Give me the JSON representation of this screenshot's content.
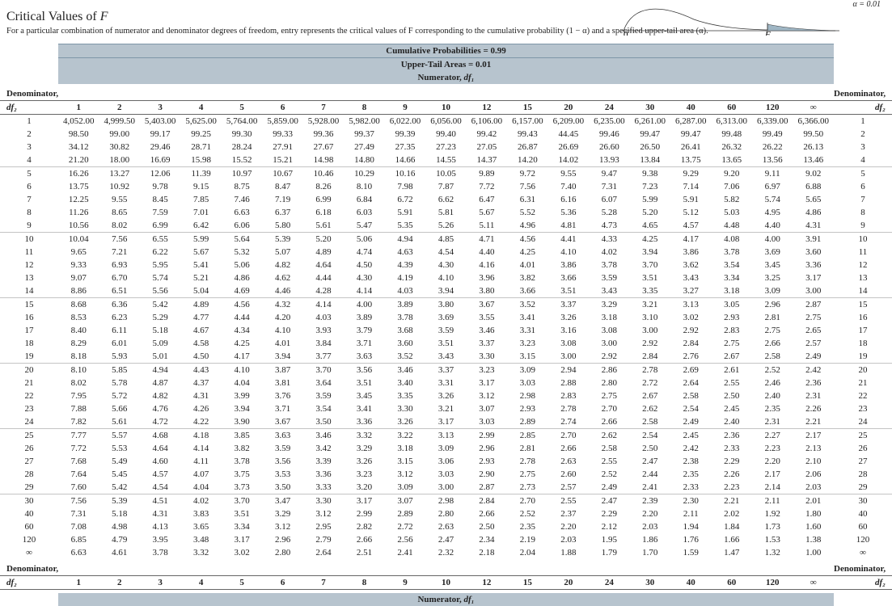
{
  "title_prefix": "Critical Values of ",
  "title_var": "F",
  "description": "For a particular combination of numerator and denominator degrees of freedom, entry represents the critical values of F corresponding to the cumulative probability (1 − α) and a specified upper-tail area (α).",
  "alpha_note": "α = 0.01",
  "curve": {
    "zero": "0",
    "F": "F"
  },
  "banners": {
    "cum": "Cumulative Probabilities = 0.99",
    "tail": "Upper-Tail Areas = 0.01",
    "numerator": "Numerator, ",
    "numerator_sym": "df₁"
  },
  "denom_label": "Denominator,",
  "denom_sym": "df₂",
  "col_headers": [
    "1",
    "2",
    "3",
    "4",
    "5",
    "6",
    "7",
    "8",
    "9",
    "10",
    "12",
    "15",
    "20",
    "24",
    "30",
    "40",
    "60",
    "120",
    "∞"
  ],
  "groups": [
    [
      {
        "df": "1",
        "v": [
          "4,052.00",
          "4,999.50",
          "5,403.00",
          "5,625.00",
          "5,764.00",
          "5,859.00",
          "5,928.00",
          "5,982.00",
          "6,022.00",
          "6,056.00",
          "6,106.00",
          "6,157.00",
          "6,209.00",
          "6,235.00",
          "6,261.00",
          "6,287.00",
          "6,313.00",
          "6,339.00",
          "6,366.00"
        ]
      },
      {
        "df": "2",
        "v": [
          "98.50",
          "99.00",
          "99.17",
          "99.25",
          "99.30",
          "99.33",
          "99.36",
          "99.37",
          "99.39",
          "99.40",
          "99.42",
          "99.43",
          "44.45",
          "99.46",
          "99.47",
          "99.47",
          "99.48",
          "99.49",
          "99.50"
        ]
      },
      {
        "df": "3",
        "v": [
          "34.12",
          "30.82",
          "29.46",
          "28.71",
          "28.24",
          "27.91",
          "27.67",
          "27.49",
          "27.35",
          "27.23",
          "27.05",
          "26.87",
          "26.69",
          "26.60",
          "26.50",
          "26.41",
          "26.32",
          "26.22",
          "26.13"
        ]
      },
      {
        "df": "4",
        "v": [
          "21.20",
          "18.00",
          "16.69",
          "15.98",
          "15.52",
          "15.21",
          "14.98",
          "14.80",
          "14.66",
          "14.55",
          "14.37",
          "14.20",
          "14.02",
          "13.93",
          "13.84",
          "13.75",
          "13.65",
          "13.56",
          "13.46"
        ]
      }
    ],
    [
      {
        "df": "5",
        "v": [
          "16.26",
          "13.27",
          "12.06",
          "11.39",
          "10.97",
          "10.67",
          "10.46",
          "10.29",
          "10.16",
          "10.05",
          "9.89",
          "9.72",
          "9.55",
          "9.47",
          "9.38",
          "9.29",
          "9.20",
          "9.11",
          "9.02"
        ]
      },
      {
        "df": "6",
        "v": [
          "13.75",
          "10.92",
          "9.78",
          "9.15",
          "8.75",
          "8.47",
          "8.26",
          "8.10",
          "7.98",
          "7.87",
          "7.72",
          "7.56",
          "7.40",
          "7.31",
          "7.23",
          "7.14",
          "7.06",
          "6.97",
          "6.88"
        ]
      },
      {
        "df": "7",
        "v": [
          "12.25",
          "9.55",
          "8.45",
          "7.85",
          "7.46",
          "7.19",
          "6.99",
          "6.84",
          "6.72",
          "6.62",
          "6.47",
          "6.31",
          "6.16",
          "6.07",
          "5.99",
          "5.91",
          "5.82",
          "5.74",
          "5.65"
        ]
      },
      {
        "df": "8",
        "v": [
          "11.26",
          "8.65",
          "7.59",
          "7.01",
          "6.63",
          "6.37",
          "6.18",
          "6.03",
          "5.91",
          "5.81",
          "5.67",
          "5.52",
          "5.36",
          "5.28",
          "5.20",
          "5.12",
          "5.03",
          "4.95",
          "4.86"
        ]
      },
      {
        "df": "9",
        "v": [
          "10.56",
          "8.02",
          "6.99",
          "6.42",
          "6.06",
          "5.80",
          "5.61",
          "5.47",
          "5.35",
          "5.26",
          "5.11",
          "4.96",
          "4.81",
          "4.73",
          "4.65",
          "4.57",
          "4.48",
          "4.40",
          "4.31"
        ]
      }
    ],
    [
      {
        "df": "10",
        "v": [
          "10.04",
          "7.56",
          "6.55",
          "5.99",
          "5.64",
          "5.39",
          "5.20",
          "5.06",
          "4.94",
          "4.85",
          "4.71",
          "4.56",
          "4.41",
          "4.33",
          "4.25",
          "4.17",
          "4.08",
          "4.00",
          "3.91"
        ]
      },
      {
        "df": "11",
        "v": [
          "9.65",
          "7.21",
          "6.22",
          "5.67",
          "5.32",
          "5.07",
          "4.89",
          "4.74",
          "4.63",
          "4.54",
          "4.40",
          "4.25",
          "4.10",
          "4.02",
          "3.94",
          "3.86",
          "3.78",
          "3.69",
          "3.60"
        ]
      },
      {
        "df": "12",
        "v": [
          "9.33",
          "6.93",
          "5.95",
          "5.41",
          "5.06",
          "4.82",
          "4.64",
          "4.50",
          "4.39",
          "4.30",
          "4.16",
          "4.01",
          "3.86",
          "3.78",
          "3.70",
          "3.62",
          "3.54",
          "3.45",
          "3.36"
        ]
      },
      {
        "df": "13",
        "v": [
          "9.07",
          "6.70",
          "5.74",
          "5.21",
          "4.86",
          "4.62",
          "4.44",
          "4.30",
          "4.19",
          "4.10",
          "3.96",
          "3.82",
          "3.66",
          "3.59",
          "3.51",
          "3.43",
          "3.34",
          "3.25",
          "3.17"
        ]
      },
      {
        "df": "14",
        "v": [
          "8.86",
          "6.51",
          "5.56",
          "5.04",
          "4.69",
          "4.46",
          "4.28",
          "4.14",
          "4.03",
          "3.94",
          "3.80",
          "3.66",
          "3.51",
          "3.43",
          "3.35",
          "3.27",
          "3.18",
          "3.09",
          "3.00"
        ]
      }
    ],
    [
      {
        "df": "15",
        "v": [
          "8.68",
          "6.36",
          "5.42",
          "4.89",
          "4.56",
          "4.32",
          "4.14",
          "4.00",
          "3.89",
          "3.80",
          "3.67",
          "3.52",
          "3.37",
          "3.29",
          "3.21",
          "3.13",
          "3.05",
          "2.96",
          "2.87"
        ]
      },
      {
        "df": "16",
        "v": [
          "8.53",
          "6.23",
          "5.29",
          "4.77",
          "4.44",
          "4.20",
          "4.03",
          "3.89",
          "3.78",
          "3.69",
          "3.55",
          "3.41",
          "3.26",
          "3.18",
          "3.10",
          "3.02",
          "2.93",
          "2.81",
          "2.75"
        ]
      },
      {
        "df": "17",
        "v": [
          "8.40",
          "6.11",
          "5.18",
          "4.67",
          "4.34",
          "4.10",
          "3.93",
          "3.79",
          "3.68",
          "3.59",
          "3.46",
          "3.31",
          "3.16",
          "3.08",
          "3.00",
          "2.92",
          "2.83",
          "2.75",
          "2.65"
        ]
      },
      {
        "df": "18",
        "v": [
          "8.29",
          "6.01",
          "5.09",
          "4.58",
          "4.25",
          "4.01",
          "3.84",
          "3.71",
          "3.60",
          "3.51",
          "3.37",
          "3.23",
          "3.08",
          "3.00",
          "2.92",
          "2.84",
          "2.75",
          "2.66",
          "2.57"
        ]
      },
      {
        "df": "19",
        "v": [
          "8.18",
          "5.93",
          "5.01",
          "4.50",
          "4.17",
          "3.94",
          "3.77",
          "3.63",
          "3.52",
          "3.43",
          "3.30",
          "3.15",
          "3.00",
          "2.92",
          "2.84",
          "2.76",
          "2.67",
          "2.58",
          "2.49"
        ]
      }
    ],
    [
      {
        "df": "20",
        "v": [
          "8.10",
          "5.85",
          "4.94",
          "4.43",
          "4.10",
          "3.87",
          "3.70",
          "3.56",
          "3.46",
          "3.37",
          "3.23",
          "3.09",
          "2.94",
          "2.86",
          "2.78",
          "2.69",
          "2.61",
          "2.52",
          "2.42"
        ]
      },
      {
        "df": "21",
        "v": [
          "8.02",
          "5.78",
          "4.87",
          "4.37",
          "4.04",
          "3.81",
          "3.64",
          "3.51",
          "3.40",
          "3.31",
          "3.17",
          "3.03",
          "2.88",
          "2.80",
          "2.72",
          "2.64",
          "2.55",
          "2.46",
          "2.36"
        ]
      },
      {
        "df": "22",
        "v": [
          "7.95",
          "5.72",
          "4.82",
          "4.31",
          "3.99",
          "3.76",
          "3.59",
          "3.45",
          "3.35",
          "3.26",
          "3.12",
          "2.98",
          "2.83",
          "2.75",
          "2.67",
          "2.58",
          "2.50",
          "2.40",
          "2.31"
        ]
      },
      {
        "df": "23",
        "v": [
          "7.88",
          "5.66",
          "4.76",
          "4.26",
          "3.94",
          "3.71",
          "3.54",
          "3.41",
          "3.30",
          "3.21",
          "3.07",
          "2.93",
          "2.78",
          "2.70",
          "2.62",
          "2.54",
          "2.45",
          "2.35",
          "2.26"
        ]
      },
      {
        "df": "24",
        "v": [
          "7.82",
          "5.61",
          "4.72",
          "4.22",
          "3.90",
          "3.67",
          "3.50",
          "3.36",
          "3.26",
          "3.17",
          "3.03",
          "2.89",
          "2.74",
          "2.66",
          "2.58",
          "2.49",
          "2.40",
          "2.31",
          "2.21"
        ]
      }
    ],
    [
      {
        "df": "25",
        "v": [
          "7.77",
          "5.57",
          "4.68",
          "4.18",
          "3.85",
          "3.63",
          "3.46",
          "3.32",
          "3.22",
          "3.13",
          "2.99",
          "2.85",
          "2.70",
          "2.62",
          "2.54",
          "2.45",
          "2.36",
          "2.27",
          "2.17"
        ]
      },
      {
        "df": "26",
        "v": [
          "7.72",
          "5.53",
          "4.64",
          "4.14",
          "3.82",
          "3.59",
          "3.42",
          "3.29",
          "3.18",
          "3.09",
          "2.96",
          "2.81",
          "2.66",
          "2.58",
          "2.50",
          "2.42",
          "2.33",
          "2.23",
          "2.13"
        ]
      },
      {
        "df": "27",
        "v": [
          "7.68",
          "5.49",
          "4.60",
          "4.11",
          "3.78",
          "3.56",
          "3.39",
          "3.26",
          "3.15",
          "3.06",
          "2.93",
          "2.78",
          "2.63",
          "2.55",
          "2.47",
          "2.38",
          "2.29",
          "2.20",
          "2.10"
        ]
      },
      {
        "df": "28",
        "v": [
          "7.64",
          "5.45",
          "4.57",
          "4.07",
          "3.75",
          "3.53",
          "3.36",
          "3.23",
          "3.12",
          "3.03",
          "2.90",
          "2.75",
          "2.60",
          "2.52",
          "2.44",
          "2.35",
          "2.26",
          "2.17",
          "2.06"
        ]
      },
      {
        "df": "29",
        "v": [
          "7.60",
          "5.42",
          "4.54",
          "4.04",
          "3.73",
          "3.50",
          "3.33",
          "3.20",
          "3.09",
          "3.00",
          "2.87",
          "2.73",
          "2.57",
          "2.49",
          "2.41",
          "2.33",
          "2.23",
          "2.14",
          "2.03"
        ]
      }
    ],
    [
      {
        "df": "30",
        "v": [
          "7.56",
          "5.39",
          "4.51",
          "4.02",
          "3.70",
          "3.47",
          "3.30",
          "3.17",
          "3.07",
          "2.98",
          "2.84",
          "2.70",
          "2.55",
          "2.47",
          "2.39",
          "2.30",
          "2.21",
          "2.11",
          "2.01"
        ]
      },
      {
        "df": "40",
        "v": [
          "7.31",
          "5.18",
          "4.31",
          "3.83",
          "3.51",
          "3.29",
          "3.12",
          "2.99",
          "2.89",
          "2.80",
          "2.66",
          "2.52",
          "2.37",
          "2.29",
          "2.20",
          "2.11",
          "2.02",
          "1.92",
          "1.80"
        ]
      },
      {
        "df": "60",
        "v": [
          "7.08",
          "4.98",
          "4.13",
          "3.65",
          "3.34",
          "3.12",
          "2.95",
          "2.82",
          "2.72",
          "2.63",
          "2.50",
          "2.35",
          "2.20",
          "2.12",
          "2.03",
          "1.94",
          "1.84",
          "1.73",
          "1.60"
        ]
      },
      {
        "df": "120",
        "v": [
          "6.85",
          "4.79",
          "3.95",
          "3.48",
          "3.17",
          "2.96",
          "2.79",
          "2.66",
          "2.56",
          "2.47",
          "2.34",
          "2.19",
          "2.03",
          "1.95",
          "1.86",
          "1.76",
          "1.66",
          "1.53",
          "1.38"
        ]
      },
      {
        "df": "∞",
        "v": [
          "6.63",
          "4.61",
          "3.78",
          "3.32",
          "3.02",
          "2.80",
          "2.64",
          "2.51",
          "2.41",
          "2.32",
          "2.18",
          "2.04",
          "1.88",
          "1.79",
          "1.70",
          "1.59",
          "1.47",
          "1.32",
          "1.00"
        ]
      }
    ]
  ]
}
